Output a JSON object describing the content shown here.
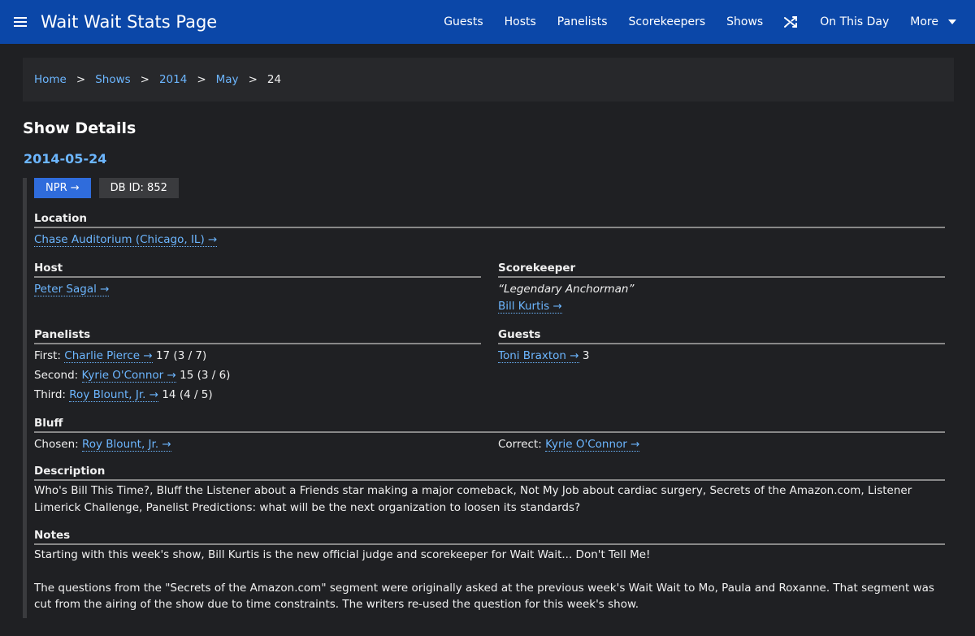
{
  "nav": {
    "brand": "Wait Wait Stats Page",
    "links": [
      "Guests",
      "Hosts",
      "Panelists",
      "Scorekeepers",
      "Shows"
    ],
    "on_this_day": "On This Day",
    "more": "More"
  },
  "breadcrumb": {
    "items": [
      "Home",
      "Shows",
      "2014",
      "May"
    ],
    "separator": ">",
    "current": "24"
  },
  "page_title": "Show Details",
  "show_date": "2014-05-24",
  "badges": {
    "npr": "NPR →",
    "db_id": "DB ID: 852"
  },
  "location": {
    "title": "Location",
    "link": "Chase Auditorium (Chicago, IL) →"
  },
  "host": {
    "title": "Host",
    "link": "Peter Sagal →"
  },
  "scorekeeper": {
    "title": "Scorekeeper",
    "quote": "“Legendary Anchorman”",
    "link": "Bill Kurtis →"
  },
  "panelists": {
    "title": "Panelists",
    "rows": [
      {
        "prefix": "First:",
        "link": "Charlie Pierce →",
        "score": "17 (3 / 7)"
      },
      {
        "prefix": "Second:",
        "link": "Kyrie O'Connor →",
        "score": "15 (3 / 6)"
      },
      {
        "prefix": "Third:",
        "link": "Roy Blount, Jr. →",
        "score": "14 (4 / 5)"
      }
    ]
  },
  "guests": {
    "title": "Guests",
    "link": "Toni Braxton →",
    "score": "3"
  },
  "bluff": {
    "title": "Bluff",
    "chosen_label": "Chosen:",
    "chosen_link": "Roy Blount, Jr. →",
    "correct_label": "Correct:",
    "correct_link": "Kyrie O'Connor →"
  },
  "description": {
    "title": "Description",
    "text": "Who's Bill This Time?, Bluff the Listener about a Friends star making a major comeback, Not My Job about cardiac surgery, Secrets of the Amazon.com, Listener Limerick Challenge, Panelist Predictions: what will be the next organization to loosen its standards?"
  },
  "notes": {
    "title": "Notes",
    "p1": "Starting with this week's show, Bill Kurtis is the new official judge and scorekeeper for Wait Wait... Don't Tell Me!",
    "p2": "The questions from the \"Secrets of the Amazon.com\" segment were originally asked at the previous week's Wait Wait to Mo, Paula and Roxanne. That segment was cut from the airing of the show due to time constraints. The writers re-used the question for this week's show."
  }
}
